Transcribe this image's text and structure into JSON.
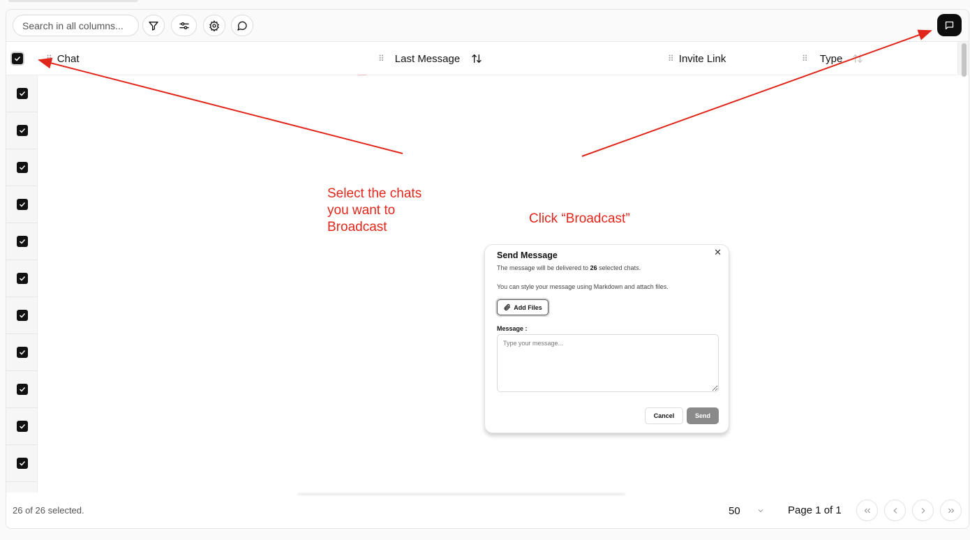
{
  "toolbar": {
    "search_placeholder": "Search in all columns...",
    "buttons": [
      {
        "name": "filter",
        "icon": "filter-icon"
      },
      {
        "name": "adjust",
        "icon": "sliders-icon"
      },
      {
        "name": "settings",
        "icon": "gear-icon"
      },
      {
        "name": "chat",
        "icon": "message-circle-icon"
      }
    ],
    "broadcast_icon": "message-square-icon"
  },
  "table": {
    "columns": [
      {
        "label": "Chat",
        "sortable": false
      },
      {
        "label": "Last Message",
        "sortable": true,
        "sort_icon": "sort-arrows-icon"
      },
      {
        "label": "Invite Link",
        "sortable": false
      },
      {
        "label": "Type",
        "sortable": true,
        "sort_icon": "sort-arrows-icon"
      }
    ],
    "header_checked": true,
    "visible_rows_checked": [
      true,
      true,
      true,
      true,
      true,
      true,
      true,
      true,
      true,
      true,
      true
    ]
  },
  "footer": {
    "selected_text": "26 of 26 selected.",
    "page_size": "50",
    "page_info": "Page 1 of 1",
    "nav_icons": [
      "first-page-icon",
      "prev-page-icon",
      "next-page-icon",
      "last-page-icon"
    ]
  },
  "modal": {
    "title": "Send Message",
    "desc_prefix": "The message will be delivered to ",
    "selected_count": "26",
    "desc_suffix": " selected chats.",
    "hint": "You can style your message using Markdown and attach files.",
    "add_files_label": "Add Files",
    "message_label": "Message :",
    "message_placeholder": "Type your message...",
    "cancel_label": "Cancel",
    "send_label": "Send",
    "close_icon": "close-icon"
  },
  "annotations": {
    "select_note_lines": [
      "Select the chats",
      "you want to",
      "Broadcast"
    ],
    "broadcast_note": "Click “Broadcast”",
    "color": "#e0261a"
  },
  "colors": {
    "accent_dark": "#0d0d0d",
    "send_disabled": "#8a8a8a",
    "annotation_red": "#e0261a"
  }
}
